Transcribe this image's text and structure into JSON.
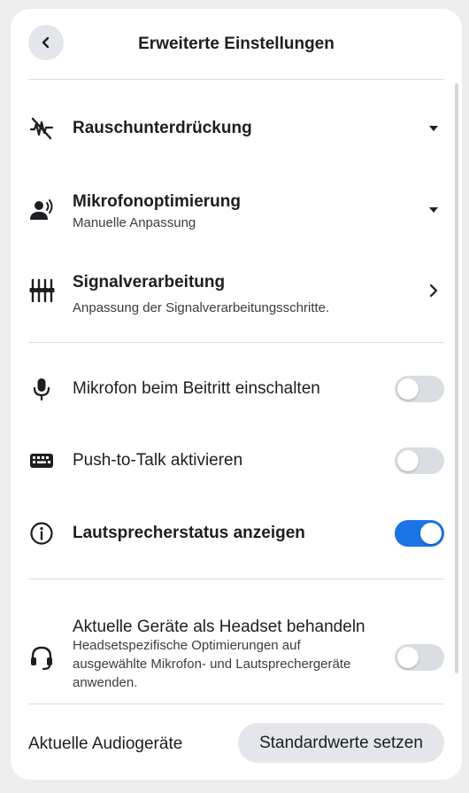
{
  "header": {
    "title": "Erweiterte Einstellungen",
    "back_icon": "chevron-left-icon"
  },
  "sections": {
    "noise": {
      "label": "Rauschunterdrückung",
      "icon": "noise-off-icon",
      "trailing": "caret-down-icon"
    },
    "mic_opt": {
      "label": "Mikrofonoptimierung",
      "sublabel": "Manuelle Anpassung",
      "icon": "speaking-person-icon",
      "trailing": "caret-down-icon"
    },
    "signal": {
      "label": "Signalverarbeitung",
      "sublabel": "Anpassung der Signalverarbeitungsschritte.",
      "icon": "equalizer-icon",
      "trailing": "chevron-right-icon"
    }
  },
  "toggles": {
    "mic_on_join": {
      "label": "Mikrofon beim Beitritt einschalten",
      "icon": "microphone-icon",
      "enabled": false
    },
    "push_to_talk": {
      "label": "Push-to-Talk aktivieren",
      "icon": "keyboard-icon",
      "enabled": false
    },
    "speaker_status": {
      "label": "Lautsprecherstatus anzeigen",
      "icon": "info-icon",
      "enabled": true
    },
    "headset": {
      "label": "Aktuelle Geräte als Headset behandeln",
      "sublabel": "Headsetspezifische Optimierungen auf ausgewählte Mikrofon- und Lautsprechergeräte anwenden.",
      "icon": "headset-icon",
      "enabled": false
    }
  },
  "footer": {
    "label": "Aktuelle Audiogeräte",
    "button": "Standardwerte setzen"
  },
  "colors": {
    "accent": "#1b74e4",
    "toggle_off": "#dadde1",
    "button_bg": "#e4e6eb"
  }
}
